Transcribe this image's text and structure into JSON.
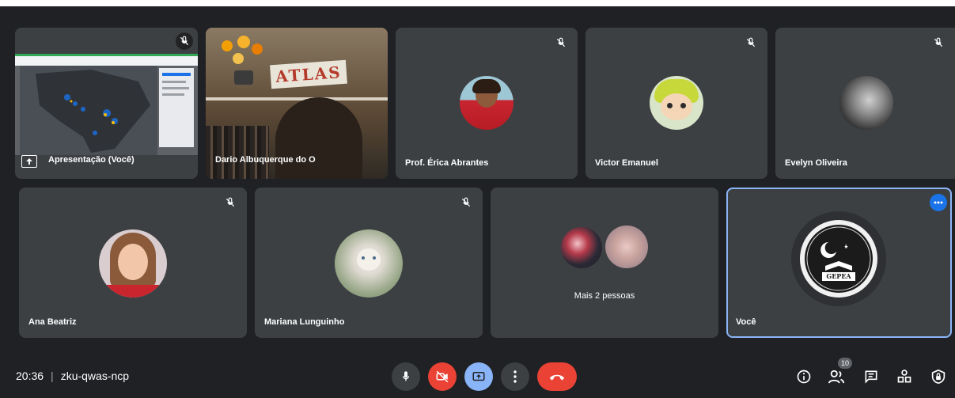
{
  "meeting": {
    "time": "20:36",
    "separator": "|",
    "code": "zku-qwas-ncp"
  },
  "tiles": [
    {
      "name": "Apresentação (Você)"
    },
    {
      "name": "Dario Albuquerque do O"
    },
    {
      "name": "Prof. Érica Abrantes"
    },
    {
      "name": "Victor Emanuel"
    },
    {
      "name": "Evelyn Oliveira"
    },
    {
      "name": "Ana Beatriz"
    },
    {
      "name": "Mariana Lunguinho"
    },
    {
      "name": "Mais 2 pessoas"
    },
    {
      "name": "Você"
    }
  ],
  "scene": {
    "atlas_sign": "ATLAS"
  },
  "logo": {
    "text": "GEPEA"
  },
  "people_count": "10",
  "colors": {
    "background": "#202124",
    "tile": "#3c4043",
    "end_call": "#ea4335",
    "active": "#8ab4f8"
  },
  "icons": [
    "mic-off-icon",
    "mic-icon",
    "camera-off-icon",
    "present-icon",
    "more-vert-icon",
    "end-call-icon",
    "info-icon",
    "people-icon",
    "chat-icon",
    "activities-icon",
    "host-controls-icon",
    "more-horiz-icon",
    "share-screen-icon"
  ]
}
